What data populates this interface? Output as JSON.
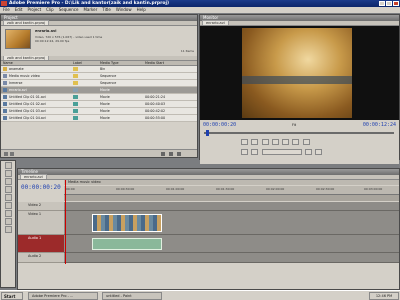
{
  "window": {
    "title": "Adobe Premiere Pro - D:\\Lik and kantor(zaik and kantin.prproj)"
  },
  "menu": [
    "File",
    "Edit",
    "Project",
    "Clip",
    "Sequence",
    "Marker",
    "Title",
    "Window",
    "Help"
  ],
  "project": {
    "title": "Project",
    "tab": "zaik and kantin.prproj",
    "clip_name": "enrario.avi",
    "info_lines": [
      "Video, 720 x 576 (1.067) - video used 1 time",
      "00:00:12:24, 29.00 fps"
    ],
    "items_count": "11 Items",
    "bin_label": "zaik and kantin.prproj",
    "columns": [
      "Name",
      "Label",
      "Media Type",
      "Media Start"
    ],
    "rows": [
      {
        "name": "anamate",
        "label_color": "#e0c050",
        "type": "Bin",
        "start": ""
      },
      {
        "name": "Media music video",
        "label_color": "#e0c050",
        "type": "Sequence",
        "start": ""
      },
      {
        "name": "Inmerse",
        "label_color": "#e0c050",
        "type": "Sequence",
        "start": ""
      },
      {
        "name": "enrario.avi",
        "label_color": "#8a9fb0",
        "type": "Movie",
        "start": "",
        "selected": true
      },
      {
        "name": "Untitled Clip 01 01.avi",
        "label_color": "#4aa098",
        "type": "Movie",
        "start": "00:00:21:24"
      },
      {
        "name": "Untitled Clip 01 02.avi",
        "label_color": "#4aa098",
        "type": "Movie",
        "start": "00:00:40:03"
      },
      {
        "name": "Untitled Clip 01 03.avi",
        "label_color": "#4aa098",
        "type": "Movie",
        "start": "00:00:42:02"
      },
      {
        "name": "Untitled Clip 01 04.avi",
        "label_color": "#4aa098",
        "type": "Movie",
        "start": "00:00:55:00"
      }
    ]
  },
  "monitor": {
    "title": "Monitor",
    "tab": "enrario.avi",
    "timecode_left": "00:00:00:20",
    "fit": "Fit",
    "timecode_right": "00:00:12:24"
  },
  "timeline": {
    "title": "Timeline",
    "tab": "enrario.avi",
    "sequence_tab": "Media music video",
    "timecode": "00:00:00:20",
    "ruler_marks": [
      "00:00",
      "00:00:30:00",
      "00:01:00:00",
      "00:01:30:00",
      "00:02:00:00",
      "00:02:30:00",
      "00:03:00:00"
    ],
    "tracks": [
      "Video 2",
      "Video 1",
      "Audio 1",
      "Audio 2"
    ]
  },
  "taskbar": {
    "start": "Start",
    "tasks": [
      "Adobe Premiere Pro - ...",
      "untitled - Paint"
    ],
    "clock": "12:46 PM"
  }
}
